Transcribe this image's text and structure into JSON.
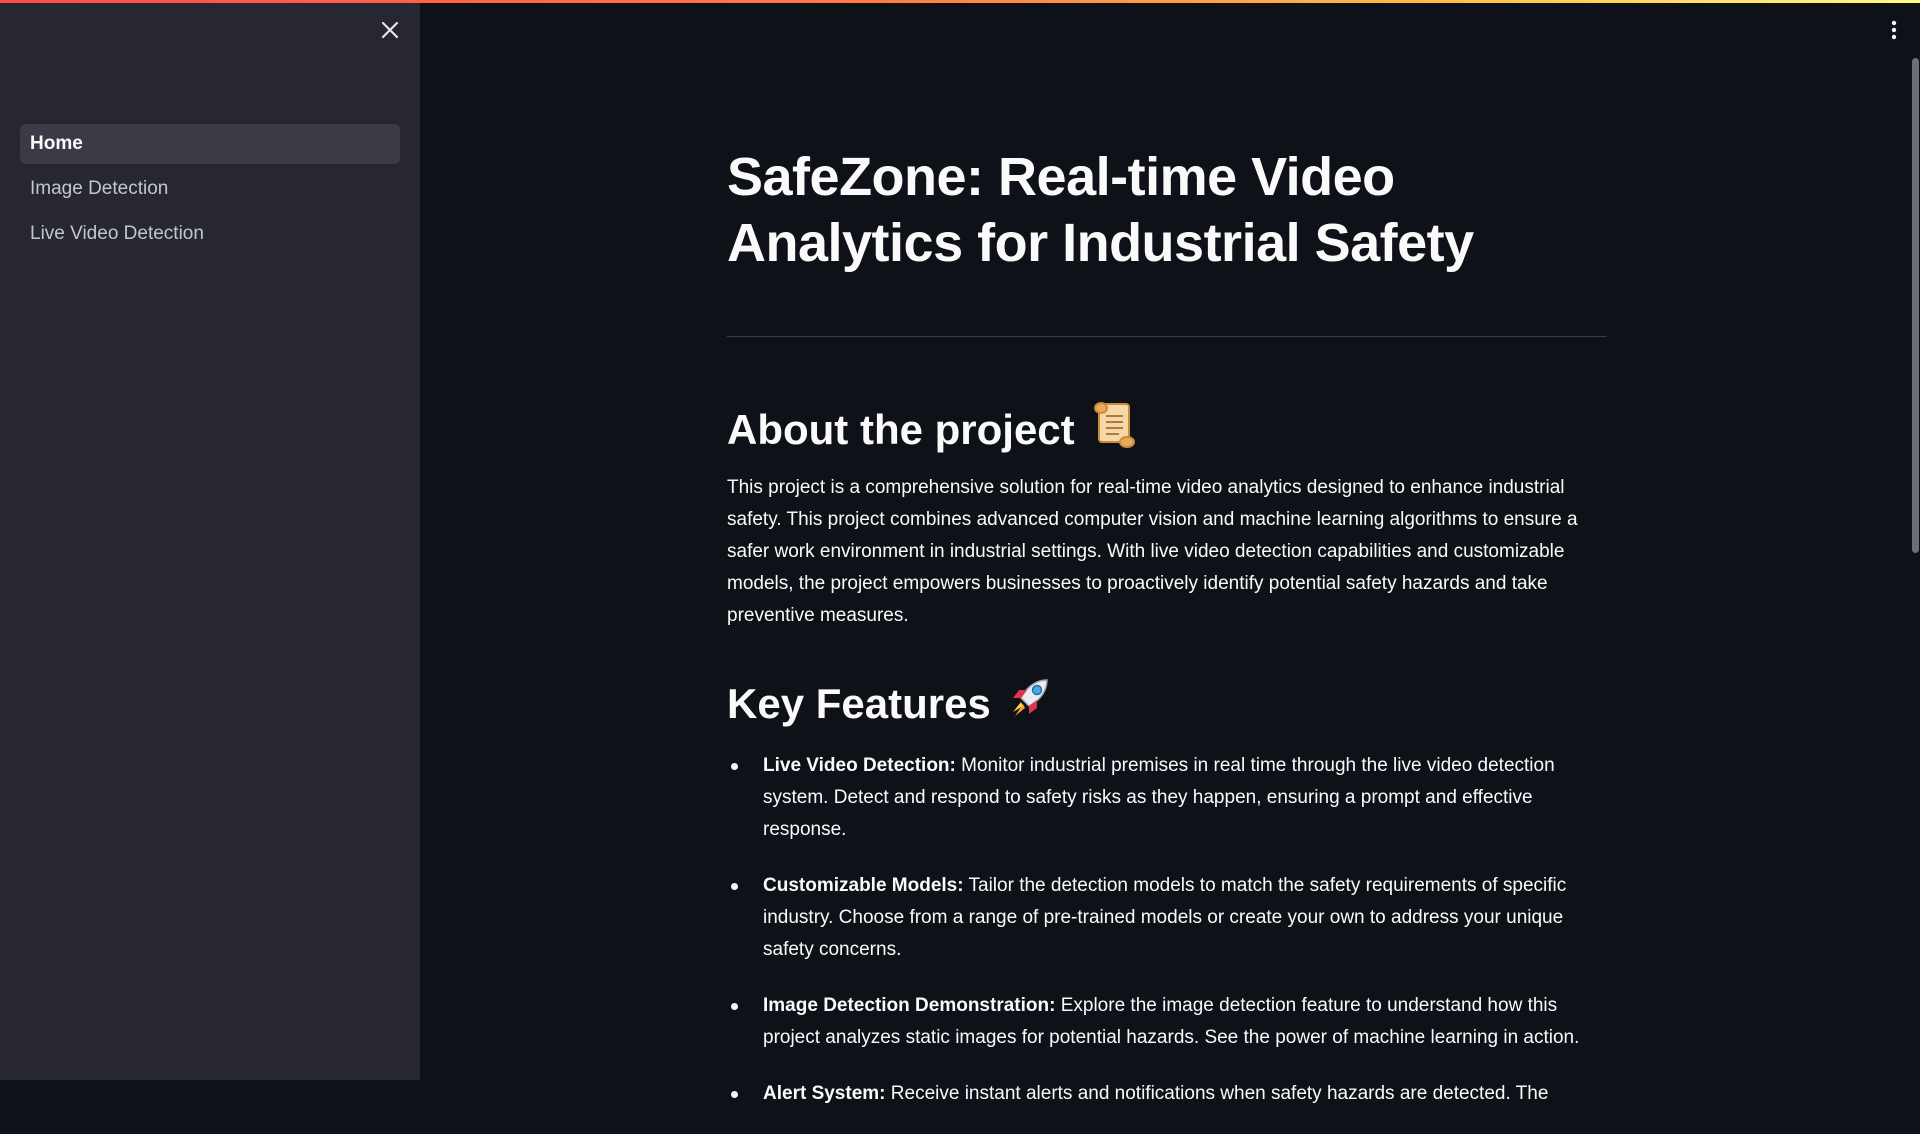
{
  "sidebar": {
    "items": [
      {
        "label": "Home"
      },
      {
        "label": "Image Detection"
      },
      {
        "label": "Live Video Detection"
      }
    ]
  },
  "icons": {
    "close": "close-icon",
    "menu": "kebab-menu-icon",
    "about_emoji": "scroll-icon",
    "features_emoji": "rocket-icon"
  },
  "colors": {
    "background": "#0e1117",
    "sidebar": "#262730",
    "active_item": "#3a3b45",
    "text": "#fafafa",
    "accent_start": "#ff4b4b",
    "accent_end": "#fffd80"
  },
  "main": {
    "title": "SafeZone: Real-time Video Analytics for Industrial Safety",
    "about": {
      "heading": "About the project",
      "text": "This project is a comprehensive solution for real-time video analytics designed to enhance industrial safety. This project combines advanced computer vision and machine learning algorithms to ensure a safer work environment in industrial settings. With live video detection capabilities and customizable models, the project empowers businesses to proactively identify potential safety hazards and take preventive measures."
    },
    "features": {
      "heading": "Key Features",
      "items": [
        {
          "title": "Live Video Detection:",
          "text": " Monitor industrial premises in real time through the live video detection system. Detect and respond to safety risks as they happen, ensuring a prompt and effective response."
        },
        {
          "title": "Customizable Models:",
          "text": " Tailor the detection models to match the safety requirements of specific industry. Choose from a range of pre-trained models or create your own to address your unique safety concerns."
        },
        {
          "title": "Image Detection Demonstration:",
          "text": " Explore the image detection feature to understand how this project analyzes static images for potential hazards. See the power of machine learning in action."
        },
        {
          "title": "Alert System:",
          "text": " Receive instant alerts and notifications when safety hazards are detected. The"
        }
      ]
    }
  }
}
